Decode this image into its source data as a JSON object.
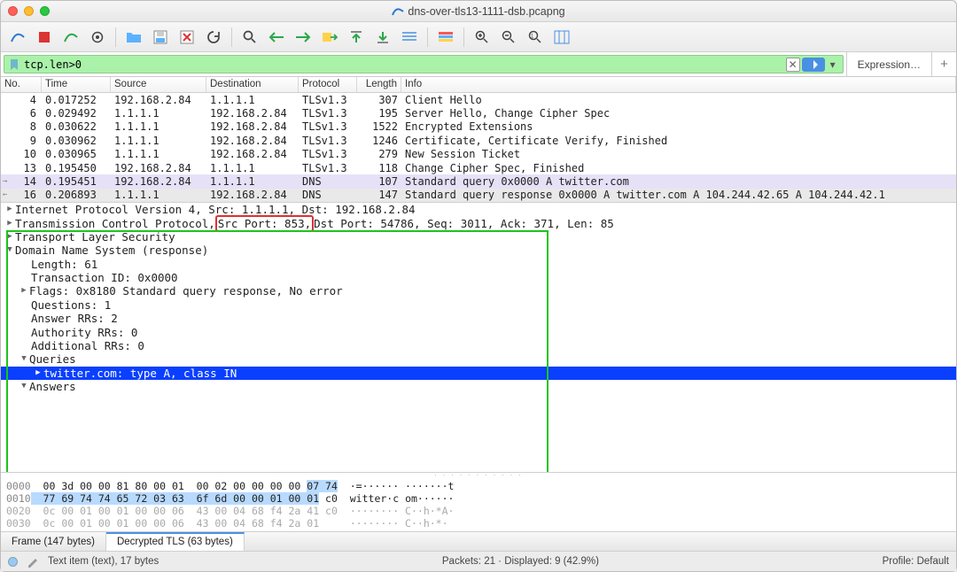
{
  "window": {
    "title": "dns-over-tls13-1111-dsb.pcapng"
  },
  "filter": {
    "value": "tcp.len>0",
    "expression_label": "Expression…"
  },
  "packet_list": {
    "columns": [
      "No.",
      "Time",
      "Source",
      "Destination",
      "Protocol",
      "Length",
      "Info"
    ],
    "rows": [
      {
        "no": "4",
        "time": "0.017252",
        "src": "192.168.2.84",
        "dst": "1.1.1.1",
        "proto": "TLSv1.3",
        "len": "307",
        "info": "Client Hello",
        "sel": ""
      },
      {
        "no": "6",
        "time": "0.029492",
        "src": "1.1.1.1",
        "dst": "192.168.2.84",
        "proto": "TLSv1.3",
        "len": "195",
        "info": "Server Hello, Change Cipher Spec",
        "sel": ""
      },
      {
        "no": "8",
        "time": "0.030622",
        "src": "1.1.1.1",
        "dst": "192.168.2.84",
        "proto": "TLSv1.3",
        "len": "1522",
        "info": "Encrypted Extensions",
        "sel": ""
      },
      {
        "no": "9",
        "time": "0.030962",
        "src": "1.1.1.1",
        "dst": "192.168.2.84",
        "proto": "TLSv1.3",
        "len": "1246",
        "info": "Certificate, Certificate Verify, Finished",
        "sel": ""
      },
      {
        "no": "10",
        "time": "0.030965",
        "src": "1.1.1.1",
        "dst": "192.168.2.84",
        "proto": "TLSv1.3",
        "len": "279",
        "info": "New Session Ticket",
        "sel": ""
      },
      {
        "no": "13",
        "time": "0.195450",
        "src": "192.168.2.84",
        "dst": "1.1.1.1",
        "proto": "TLSv1.3",
        "len": "118",
        "info": "Change Cipher Spec, Finished",
        "sel": ""
      },
      {
        "no": "14",
        "time": "0.195451",
        "src": "192.168.2.84",
        "dst": "1.1.1.1",
        "proto": "DNS",
        "len": "107",
        "info": "Standard query 0x0000 A twitter.com",
        "sel": "sel",
        "arrow": "→"
      },
      {
        "no": "16",
        "time": "0.206893",
        "src": "1.1.1.1",
        "dst": "192.168.2.84",
        "proto": "DNS",
        "len": "147",
        "info": "Standard query response 0x0000 A twitter.com A 104.244.42.65 A 104.244.42.1",
        "sel": "sel2",
        "arrow": "←"
      }
    ]
  },
  "details": {
    "line0": "Internet Protocol Version 4, Src: 1.1.1.1, Dst: 192.168.2.84",
    "line1_pre": "Transmission Control Protocol, ",
    "line1_red": "Src Port: 853,",
    "line1_post": " Dst Port: 54786, Seq: 3011, Ack: 371, Len: 85",
    "line2": "Transport Layer Security",
    "line3": "Domain Name System (response)",
    "line4": "Length: 61",
    "line5": "Transaction ID: 0x0000",
    "line6": "Flags: 0x8180 Standard query response, No error",
    "line7": "Questions: 1",
    "line8": "Answer RRs: 2",
    "line9": "Authority RRs: 0",
    "line10": "Additional RRs: 0",
    "line11": "Queries",
    "line12": "twitter.com: type A, class IN",
    "line13": "Answers"
  },
  "hex": {
    "l0_off": "0000",
    "l0_hex_a": "  00 3d 00 00 81 80 00 01  00 02 00 00 00 00 ",
    "l0_hex_hl": "07 74",
    "l0_asc": "  ·=······ ·······t",
    "l1_off": "0010",
    "l1_hex_hl": "  77 69 74 74 65 72 03 63  6f 6d 00 00 01 00 01",
    "l1_hex_b": " c0",
    "l1_asc": "  witter·c om······",
    "l2_off": "0020",
    "l2_hex": "  0c 00 01 00 01 00 00 06  43 00 04 68 f4 2a 41 c0",
    "l2_asc": "  ········ C··h·*A·",
    "l3_off": "0030",
    "l3_hex": "  0c 00 01 00 01 00 00 06  43 00 04 68 f4 2a 01   ",
    "l3_asc": "  ········ C··h·*· "
  },
  "bottom_tabs": {
    "tab0": "Frame (147 bytes)",
    "tab1": "Decrypted TLS (63 bytes)"
  },
  "status": {
    "left": "Text item (text), 17 bytes",
    "packets": "Packets: 21 · Displayed: 9 (42.9%)",
    "profile": "Profile: Default"
  }
}
